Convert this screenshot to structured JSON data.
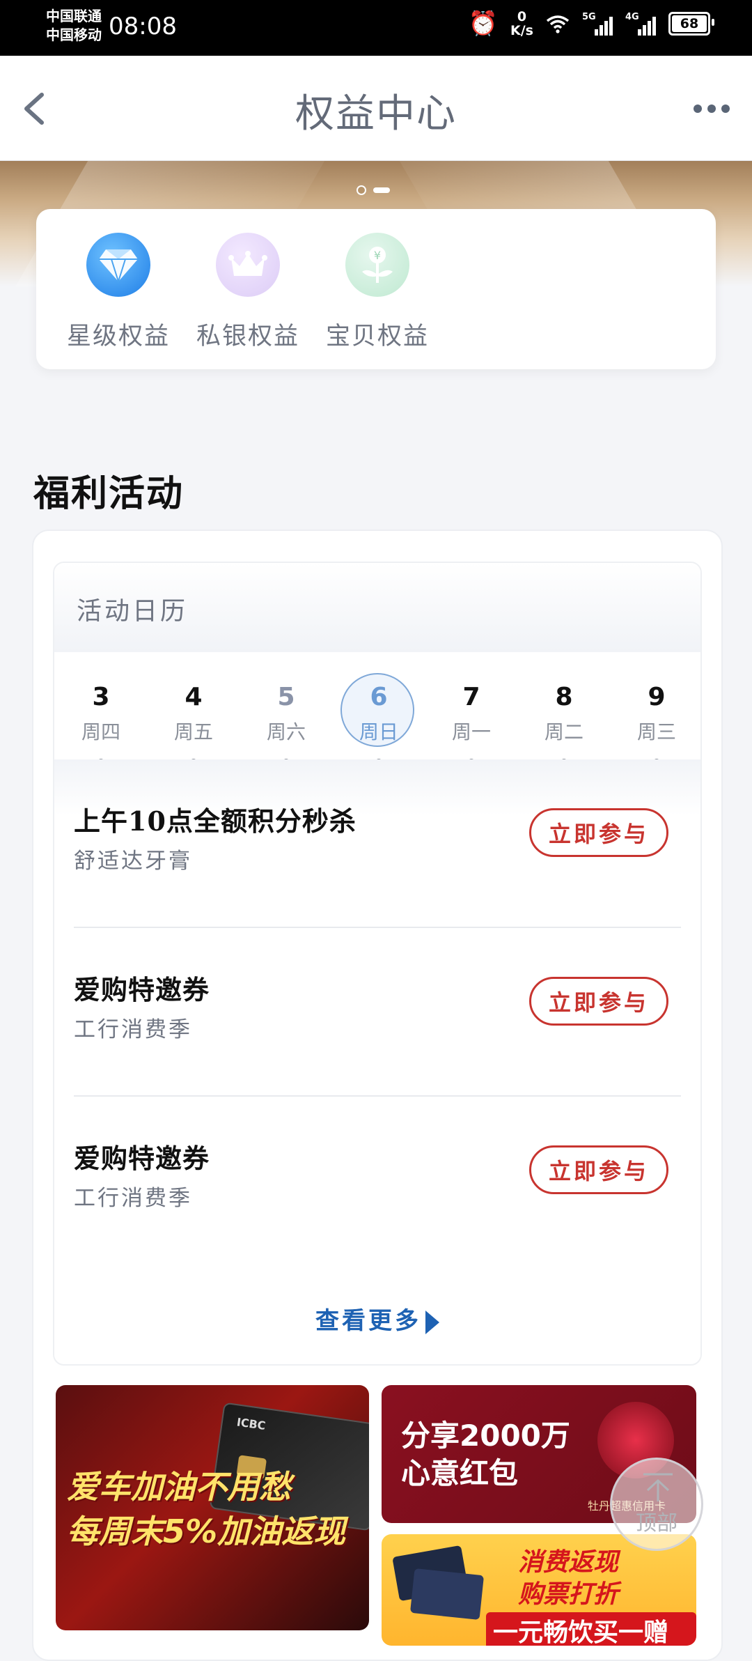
{
  "status_bar": {
    "carrier_1": "中国联通",
    "carrier_2": "中国移动",
    "time": "08:08",
    "net_speed_value": "0",
    "net_speed_unit": "K/s",
    "signal_1_label": "5G",
    "signal_2_label": "4G",
    "battery": "68"
  },
  "header": {
    "title": "权益中心",
    "back_icon": "chevron-left-icon",
    "more_icon": "more-horizontal-icon"
  },
  "carousel": {
    "pages": 2,
    "active_index": 0
  },
  "benefits": [
    {
      "label": "星级权益",
      "icon": "diamond-icon"
    },
    {
      "label": "私银权益",
      "icon": "crown-icon"
    },
    {
      "label": "宝贝权益",
      "icon": "sprout-coin-icon"
    }
  ],
  "welfare": {
    "section_title": "福利活动",
    "calendar_title": "活动日历",
    "days": [
      {
        "num": "3",
        "weekday": "周四"
      },
      {
        "num": "4",
        "weekday": "周五"
      },
      {
        "num": "5",
        "weekday": "周六"
      },
      {
        "num": "6",
        "weekday": "周日",
        "selected": true
      },
      {
        "num": "7",
        "weekday": "周一"
      },
      {
        "num": "8",
        "weekday": "周二"
      },
      {
        "num": "9",
        "weekday": "周三"
      }
    ],
    "activities": [
      {
        "title": "上午10点全额积分秒杀",
        "subtitle": "舒适达牙膏",
        "button": "立即参与"
      },
      {
        "title": "爱购特邀券",
        "subtitle": "工行消费季",
        "button": "立即参与"
      },
      {
        "title": "爱购特邀券",
        "subtitle": "工行消费季",
        "button": "立即参与"
      }
    ],
    "see_more": "查看更多"
  },
  "promos": {
    "fuel": {
      "line1": "爱车加油不用愁",
      "line2": "每周末5%加油返现",
      "card_brand": "ICBC"
    },
    "red_packet": {
      "line1": "分享2000万",
      "line2": "心意红包",
      "caption": "牡丹超惠信用卡"
    },
    "consume": {
      "line1": "消费返现",
      "line2": "购票打折",
      "line3": "一元畅饮买一赠一"
    }
  },
  "back_to_top": {
    "label": "顶部"
  },
  "colors": {
    "accent_red": "#c8342f",
    "link_blue": "#1e62b3",
    "selected_day": "#6a9ad3",
    "banner_gold": "#c9a982"
  }
}
